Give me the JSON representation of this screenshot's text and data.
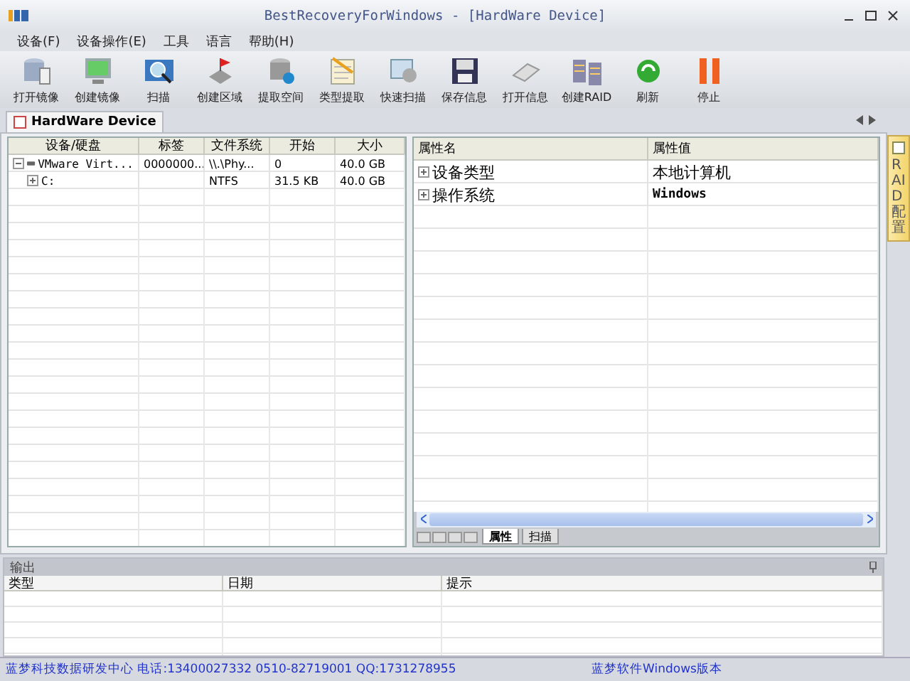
{
  "window": {
    "title": "BestRecoveryForWindows - [HardWare Device]"
  },
  "menu": [
    "设备(F)",
    "设备操作(E)",
    "工具",
    "语言",
    "帮助(H)"
  ],
  "toolbar": [
    "打开镜像",
    "创建镜像",
    "扫描",
    "创建区域",
    "提取空间",
    "类型提取",
    "快速扫描",
    "保存信息",
    "打开信息",
    "创建RAID",
    "刷新",
    "停止"
  ],
  "document_tab": {
    "label": "HardWare Device",
    "selected": true
  },
  "side_tab": {
    "label": "RAID配置"
  },
  "device_table": {
    "columns": [
      "设备/硬盘",
      "标签",
      "文件系统",
      "开始",
      "大小"
    ],
    "rows": [
      {
        "cells": [
          "VMware Virt...",
          "0000000...",
          "\\\\.\\Phy...",
          "0",
          "40.0 GB"
        ],
        "expanded": true,
        "children": [
          {
            "cells": [
              "C:",
              "",
              "NTFS",
              "31.5 KB",
              "40.0 GB"
            ],
            "expanded": false
          }
        ]
      }
    ]
  },
  "property_table": {
    "columns": [
      "属性名",
      "属性值"
    ],
    "rows": [
      {
        "name": "设备类型",
        "value": "本地计算机"
      },
      {
        "name": "操作系统",
        "value": "Windows"
      }
    ]
  },
  "property_tabs": [
    {
      "label": "属性",
      "selected": true
    },
    {
      "label": "扫描",
      "selected": false
    }
  ],
  "output": {
    "title": "输出",
    "columns": [
      "类型",
      "日期",
      "提示"
    ]
  },
  "status_bar": [
    "蓝梦科技数据研发中心 电话:13400027332 0510-82719001 QQ:1731278955",
    "蓝梦软件Windows版本"
  ]
}
